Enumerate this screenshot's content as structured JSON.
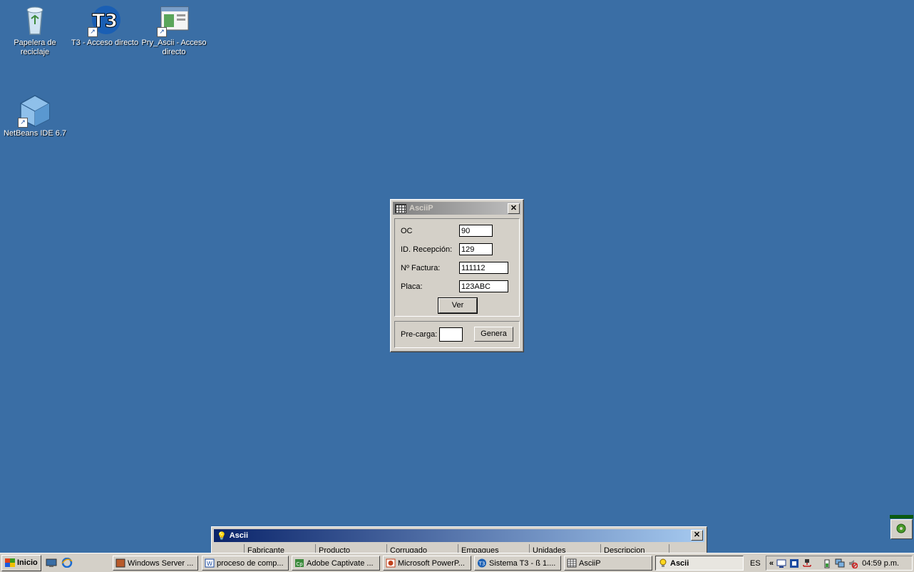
{
  "desktop": {
    "icons": [
      {
        "label": "Papelera de reciclaje",
        "icon": "recycle-bin-icon"
      },
      {
        "label": "T3 - Acceso directo",
        "icon": "t3-app-icon"
      },
      {
        "label": "Pry_Ascii - Acceso directo",
        "icon": "window-app-icon"
      },
      {
        "label": "NetBeans IDE 6.7",
        "icon": "netbeans-icon"
      }
    ]
  },
  "dialog": {
    "title": "AsciiP",
    "fields": [
      {
        "label": "OC",
        "value": "90"
      },
      {
        "label": "ID. Recepción:",
        "value": "129"
      },
      {
        "label": "Nº Factura:",
        "value": "111112"
      },
      {
        "label": "Placa:",
        "value": "123ABC"
      }
    ],
    "ver_label": "Ver",
    "precarga_label": "Pre-carga:",
    "precarga_value": "",
    "genera_label": "Genera",
    "close_glyph": "✕"
  },
  "ascii_window": {
    "title": "Ascii",
    "columns": [
      "",
      "Fabricante",
      "Producto",
      "Corrugado",
      "Empaques",
      "Unidades",
      "Descripcion"
    ]
  },
  "taskbar": {
    "start_label": "Inicio",
    "tasks": [
      {
        "label": "Windows Server ...",
        "icon": "server-icon"
      },
      {
        "label": "proceso de comp...",
        "icon": "word-doc-icon"
      },
      {
        "label": "Adobe Captivate ...",
        "icon": "captivate-icon"
      },
      {
        "label": "Microsoft PowerP...",
        "icon": "powerpoint-icon"
      },
      {
        "label": "Sistema T3 - ß 1....",
        "icon": "t3-app-icon"
      },
      {
        "label": "AsciiP",
        "icon": "table-icon"
      },
      {
        "label": "Ascii",
        "icon": "lightbulb-icon"
      }
    ],
    "language": "ES",
    "tray_chevron": "«",
    "clock": "04:59 p.m."
  }
}
